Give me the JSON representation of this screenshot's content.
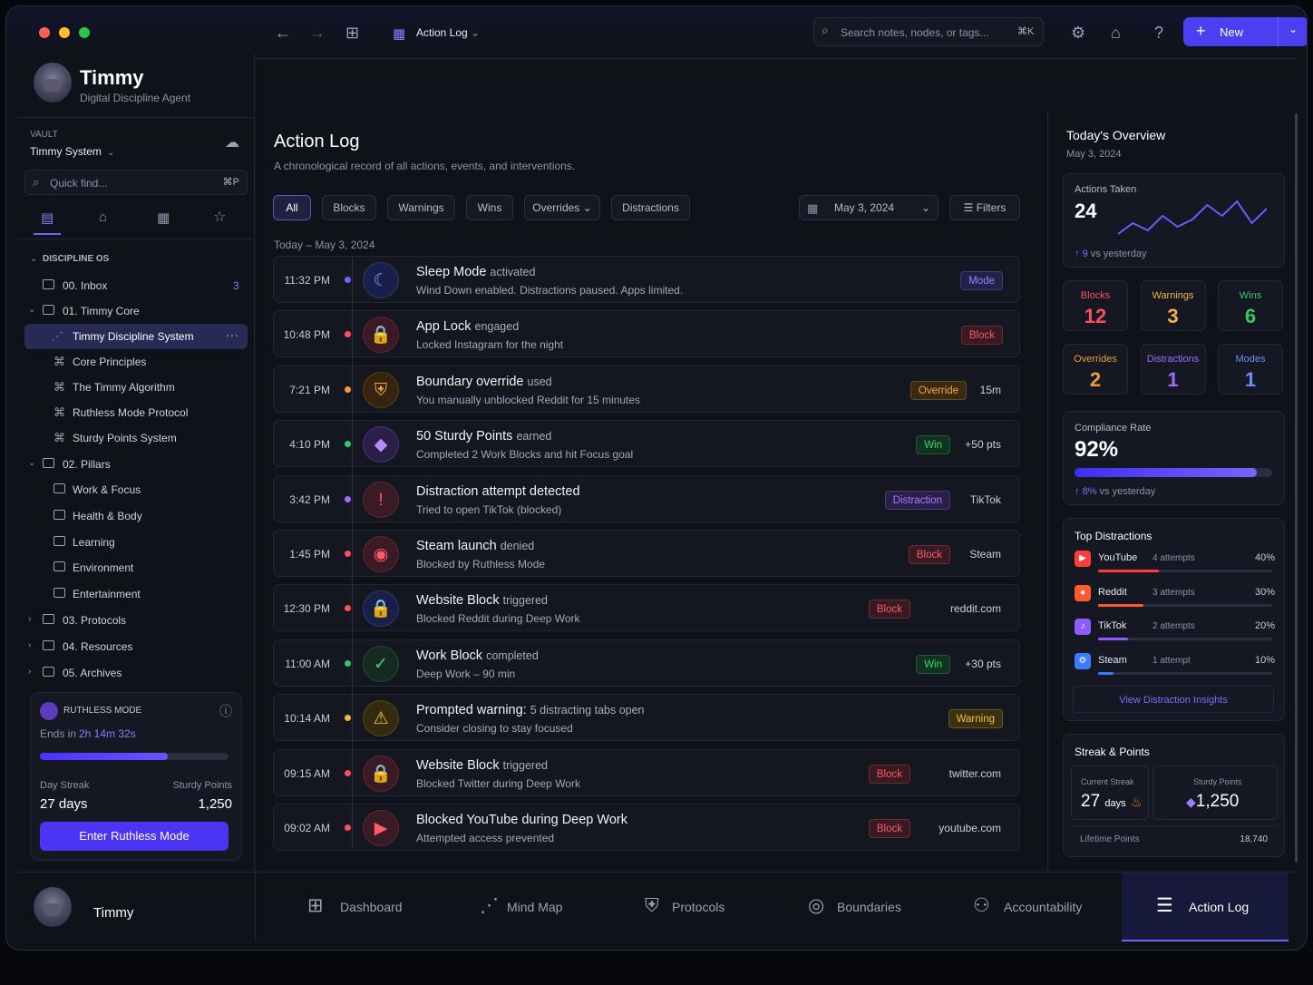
{
  "window": {
    "controls": [
      "–",
      "☐",
      "✕"
    ]
  },
  "sidebar": {
    "user": {
      "name": "Timmy",
      "subtitle": "Digital Discipline Agent"
    },
    "vault": {
      "label": "VAULT",
      "name": "Timmy System"
    },
    "quick_find": {
      "placeholder": "Quick find...",
      "shortcut": "⌘P"
    },
    "section": "DISCIPLINE OS",
    "inbox": {
      "label": "00. Inbox",
      "count": "3"
    },
    "core": "01. Timmy Core",
    "core_items": [
      "Timmy Discipline System",
      "Core Principles",
      "The Timmy Algorithm",
      "Ruthless Mode Protocol",
      "Sturdy Points System"
    ],
    "pillars": "02. Pillars",
    "pillar_items": [
      "Work & Focus",
      "Health & Body",
      "Learning",
      "Environment",
      "Entertainment"
    ],
    "protocols": "03. Protocols",
    "resources": "04. Resources",
    "archives": "05. Archives",
    "ruthless": {
      "title": "RUTHLESS MODE",
      "ends_label": "Ends in",
      "ends_value": "2h 14m 32s",
      "progress": 0.68,
      "streak_label": "Day Streak",
      "streak_value": "27 days",
      "points_label": "Sturdy Points",
      "points_value": "1,250",
      "button": "Enter Ruthless Mode"
    }
  },
  "topbar": {
    "breadcrumb": "Action Log",
    "search_placeholder": "Search notes, nodes, or tags...",
    "search_shortcut": "⌘K",
    "new_label": "New"
  },
  "main": {
    "title": "Action Log",
    "subtitle": "A chronological record of all actions, events, and interventions.",
    "filters": [
      "All",
      "Blocks",
      "Warnings",
      "Wins",
      "Overrides",
      "Distractions"
    ],
    "date": "May 3, 2024",
    "filters_button": "Filters",
    "group_label": "Today – May 3, 2024",
    "rows": [
      {
        "time": "11:32 PM",
        "title": "Sleep Mode",
        "verb": "activated",
        "sub": "Wind Down enabled. Distractions paused. Apps limited.",
        "tag": "Mode",
        "meta": ""
      },
      {
        "time": "10:48 PM",
        "title": "App Lock",
        "verb": "engaged",
        "sub": "Locked Instagram for the night",
        "tag": "Block",
        "meta": ""
      },
      {
        "time": "7:21 PM",
        "title": "Boundary override",
        "verb": "used",
        "sub": "You manually unblocked Reddit for 15 minutes",
        "tag": "Override",
        "meta": "15m"
      },
      {
        "time": "4:10 PM",
        "title": "50 Sturdy Points",
        "verb": "earned",
        "sub": "Completed 2 Work Blocks and hit Focus goal",
        "tag": "Win",
        "meta": "+50 pts"
      },
      {
        "time": "3:42 PM",
        "title": "Distraction attempt detected",
        "verb": "",
        "sub": "Tried to open TikTok (blocked)",
        "tag": "Distraction",
        "meta": "TikTok"
      },
      {
        "time": "1:45 PM",
        "title": "Steam launch",
        "verb": "denied",
        "sub": "Blocked by Ruthless Mode",
        "tag": "Block",
        "meta": "Steam"
      },
      {
        "time": "12:30 PM",
        "title": "Website Block",
        "verb": "triggered",
        "sub": "Blocked Reddit during Deep Work",
        "tag": "Block",
        "meta": "reddit.com"
      },
      {
        "time": "11:00 AM",
        "title": "Work Block",
        "verb": "completed",
        "sub": "Deep Work – 90 min",
        "tag": "Win",
        "meta": "+30 pts"
      },
      {
        "time": "10:14 AM",
        "title": "Prompted warning:",
        "verb": "5 distracting tabs open",
        "sub": "Consider closing to stay focused",
        "tag": "Warning",
        "meta": ""
      },
      {
        "time": "09:15 AM",
        "title": "Website Block",
        "verb": "triggered",
        "sub": "Blocked Twitter during Deep Work",
        "tag": "Block",
        "meta": "twitter.com"
      },
      {
        "time": "09:02 AM",
        "title": "Blocked YouTube during Deep Work",
        "verb": "",
        "sub": "Attempted access prevented",
        "tag": "Block",
        "meta": "youtube.com"
      }
    ]
  },
  "overview": {
    "title": "Today's Overview",
    "date": "May 3, 2024",
    "actions": {
      "label": "Actions Taken",
      "value": "24",
      "delta": "9",
      "delta_label": "vs yesterday",
      "spark": [
        7,
        10,
        8,
        12,
        9,
        11,
        15,
        12,
        16,
        10,
        14
      ]
    },
    "stats": [
      {
        "label": "Blocks",
        "value": "12",
        "color": "#ff4d5a"
      },
      {
        "label": "Warnings",
        "value": "3",
        "color": "#f2b544"
      },
      {
        "label": "Wins",
        "value": "6",
        "color": "#35c86b"
      },
      {
        "label": "Overrides",
        "value": "2",
        "color": "#f29a38"
      },
      {
        "label": "Distractions",
        "value": "1",
        "color": "#a06bff"
      },
      {
        "label": "Modes",
        "value": "1",
        "color": "#6f8cff"
      }
    ],
    "compliance": {
      "label": "Compliance Rate",
      "value": "92%",
      "fill": 0.92,
      "delta": "8%",
      "delta_label": "vs yesterday"
    },
    "top_distractions": {
      "title": "Top Distractions",
      "items": [
        {
          "name": "YouTube",
          "attempts": "4 attempts",
          "pct": "40%",
          "fill": 0.4,
          "color": "#ff3d3d"
        },
        {
          "name": "Reddit",
          "attempts": "3 attempts",
          "pct": "30%",
          "fill": 0.3,
          "color": "#ff5a2a"
        },
        {
          "name": "TikTok",
          "attempts": "2 attempts",
          "pct": "20%",
          "fill": 0.2,
          "color": "#8c5cff"
        },
        {
          "name": "Steam",
          "attempts": "1 attempt",
          "pct": "10%",
          "fill": 0.1,
          "color": "#3c7bff"
        }
      ],
      "link": "View Distraction Insights"
    },
    "streak": {
      "title": "Streak & Points",
      "current_label": "Current Streak",
      "current_value": "27",
      "current_unit": "days",
      "points_label": "Sturdy Points",
      "points_value": "1,250",
      "lifetime_label": "Lifetime Points",
      "lifetime_value": "18,740"
    }
  },
  "bottom": {
    "user": "Timmy",
    "tabs": [
      "Dashboard",
      "Mind Map",
      "Protocols",
      "Boundaries",
      "Accountability",
      "Action Log"
    ]
  }
}
